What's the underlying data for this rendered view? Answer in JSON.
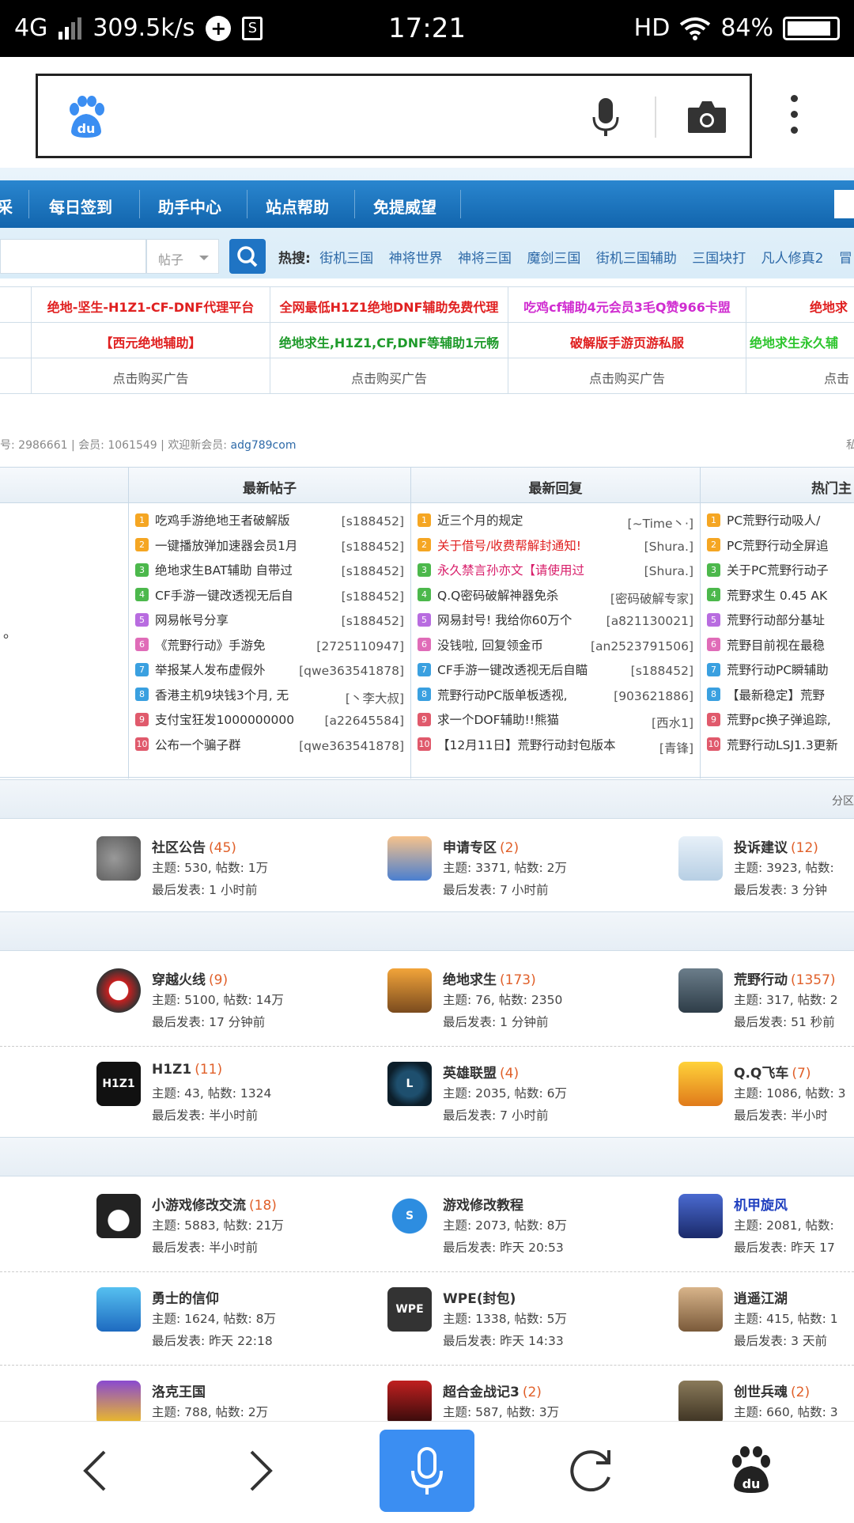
{
  "status_bar": {
    "network": "4G",
    "speed": "309.5k/s",
    "time": "17:21",
    "hd": "HD",
    "battery": "84%"
  },
  "browser": {
    "search_placeholder": "",
    "icons": [
      "baidu-paw-icon",
      "microphone-icon",
      "camera-icon",
      "more-vertical-icon"
    ]
  },
  "nav": {
    "partial_left": "采",
    "items": [
      "每日签到",
      "助手中心",
      "站点帮助",
      "免提威望"
    ]
  },
  "search": {
    "select_label": "帖子",
    "hot_label": "热搜:",
    "hot_terms": [
      "街机三国",
      "神将世界",
      "神将三国",
      "魔剑三国",
      "街机三国辅助",
      "三国块打",
      "凡人修真2",
      "冒"
    ]
  },
  "ads": {
    "row1": [
      "绝地-坚生-H1Z1-CF-DNF代理平台",
      "全网最低H1Z1绝地DNF辅助免费代理",
      "吃鸡cf辅助4元会员3毛Q赞966卡盟",
      "绝地求"
    ],
    "row2": [
      "【西元绝地辅助】",
      "绝地求生,H1Z1,CF,DNF等辅助1元畅",
      "破解版手游页游私服",
      "绝地求生永久辅"
    ],
    "row3": [
      "点击购买广告",
      "点击购买广告",
      "点击购买广告",
      "点击"
    ]
  },
  "stats": {
    "posts": "号: 2986661",
    "members": "会员: 1061549",
    "welcome": "欢迎新会员: ",
    "new_member": "adg789com",
    "right_partial": "私"
  },
  "lists": {
    "headers": [
      "最新帖子",
      "最新回复",
      "热门主"
    ],
    "left_partial": "。",
    "latest_posts": [
      {
        "title": "吃鸡手游绝地王者破解版",
        "author": "[s188452]"
      },
      {
        "title": "一键播放弹加速器会员1月",
        "author": "[s188452]"
      },
      {
        "title": "绝地求生BAT辅助 自带过",
        "author": "[s188452]"
      },
      {
        "title": "CF手游一键改透视无后自",
        "author": "[s188452]"
      },
      {
        "title": "网易帐号分享",
        "author": "[s188452]"
      },
      {
        "title": "《荒野行动》手游免",
        "author": "[2725110947]"
      },
      {
        "title": "举报某人发布虚假外",
        "author": "[qwe363541878]"
      },
      {
        "title": "香港主机9块钱3个月, 无",
        "author": "[丶李大叔]"
      },
      {
        "title": "支付宝狂发1000000000",
        "author": "[a22645584]"
      },
      {
        "title": "公布一个骗子群",
        "author": "[qwe363541878]"
      }
    ],
    "latest_replies": [
      {
        "title": "近三个月的规定",
        "author": "[~Time丶·]",
        "color": "#333"
      },
      {
        "title": "关于借号/收费帮解封通知!",
        "author": "[Shura.]",
        "color": "#e02020"
      },
      {
        "title": "永久禁言孙亦文【请使用过",
        "author": "[Shura.]",
        "color": "#d81e6a"
      },
      {
        "title": "Q.Q密码破解神器免杀",
        "author": "[密码破解专家]",
        "color": "#333"
      },
      {
        "title": "网易封号! 我给你60万个",
        "author": "[a821130021]",
        "color": "#333"
      },
      {
        "title": "没钱啦, 回复领金币",
        "author": "[an2523791506]",
        "color": "#333"
      },
      {
        "title": "CF手游一键改透视无后自瞄",
        "author": "[s188452]",
        "color": "#333"
      },
      {
        "title": "荒野行动PC版单板透视,",
        "author": "[903621886]",
        "color": "#333"
      },
      {
        "title": "求一个DOF辅助!!熊猫",
        "author": "[西水1]",
        "color": "#333"
      },
      {
        "title": "【12月11日】荒野行动封包版本",
        "author": "[青锋]",
        "color": "#333"
      }
    ],
    "hot_topics": [
      "PC荒野行动吸人/",
      "PC荒野行动全屏追",
      "关于PC荒野行动子",
      "荒野求生 0.45 AK",
      "荒野行动部分基址",
      "荒野目前视在最稳",
      "荒野行动PC瞬辅助",
      "【最新稳定】荒野",
      "荒野pc换子弹追踪,",
      "荒野行动LSJ1.3更新"
    ]
  },
  "section1": {
    "right_label": "分区"
  },
  "forums": [
    {
      "name": "社区公告",
      "count": "(45)",
      "topics": "主题: 530, 帖数: 1万",
      "last": "最后发表: 1 小时前",
      "icon": "speaker-icon",
      "name_color": "#333"
    },
    {
      "name": "申请专区",
      "count": "(2)",
      "topics": "主题: 3371, 帖数: 2万",
      "last": "最后发表: 7 小时前",
      "icon": "reading-kid-icon",
      "name_color": "#333"
    },
    {
      "name": "投诉建议",
      "count": "(12)",
      "topics": "主题: 3923, 帖数:",
      "last": "最后发表: 3 分钟",
      "icon": "paper-plane-icon",
      "name_color": "#333"
    },
    {
      "name": "穿越火线",
      "count": "(9)",
      "topics": "主题: 5100, 帖数: 14万",
      "last": "最后发表: 17 分钟前",
      "icon": "crossfire-logo-icon",
      "name_color": "#333"
    },
    {
      "name": "绝地求生",
      "count": "(173)",
      "topics": "主题: 76, 帖数: 2350",
      "last": "最后发表: 1 分钟前",
      "icon": "pubg-icon",
      "name_color": "#333"
    },
    {
      "name": "荒野行动",
      "count": "(1357)",
      "topics": "主题: 317, 帖数: 2",
      "last": "最后发表: 51 秒前",
      "icon": "knives-out-icon",
      "name_color": "#333"
    },
    {
      "name": "H1Z1",
      "count": "(11)",
      "topics": "主题: 43, 帖数: 1324",
      "last": "最后发表: 半小时前",
      "icon": "h1z1-logo-icon",
      "name_color": "#333"
    },
    {
      "name": "英雄联盟",
      "count": "(4)",
      "topics": "主题: 2035, 帖数: 6万",
      "last": "最后发表: 7 小时前",
      "icon": "lol-logo-icon",
      "name_color": "#333"
    },
    {
      "name": "Q.Q飞车",
      "count": "(7)",
      "topics": "主题: 1086, 帖数: 3",
      "last": "最后发表: 半小时",
      "icon": "qq-speed-icon",
      "name_color": "#333"
    },
    {
      "name": "小游戏修改交流",
      "count": "(18)",
      "topics": "主题: 5883, 帖数: 21万",
      "last": "最后发表: 半小时前",
      "icon": "penguin-icon",
      "name_color": "#333"
    },
    {
      "name": "游戏修改教程",
      "count": "",
      "topics": "主题: 2073, 帖数: 8万",
      "last": "最后发表: 昨天 20:53",
      "icon": "skype-s-icon",
      "name_color": "#333"
    },
    {
      "name": "机甲旋风",
      "count": "",
      "topics": "主题: 2081, 帖数:",
      "last": "最后发表: 昨天 17",
      "icon": "mecha-icon",
      "name_color": "#1f3fbf"
    },
    {
      "name": "勇士的信仰",
      "count": "",
      "topics": "主题: 1624, 帖数: 8万",
      "last": "最后发表: 昨天 22:18",
      "icon": "warrior-icon",
      "name_color": "#333"
    },
    {
      "name": "WPE(封包)",
      "count": "",
      "topics": "主题: 1338, 帖数: 5万",
      "last": "最后发表: 昨天 14:33",
      "icon": "wpe-logo-icon",
      "name_color": "#333"
    },
    {
      "name": "逍遥江湖",
      "count": "",
      "topics": "主题: 415, 帖数: 1",
      "last": "最后发表: 3 天前",
      "icon": "jianghu-icon",
      "name_color": "#333"
    },
    {
      "name": "洛克王国",
      "count": "",
      "topics": "主题: 788, 帖数: 2万",
      "last": "",
      "icon": "roco-icon",
      "name_color": "#333"
    },
    {
      "name": "超合金战记3",
      "count": "(2)",
      "topics": "主题: 587, 帖数: 3万",
      "last": "",
      "icon": "alloy-warrior-icon",
      "name_color": "#333"
    },
    {
      "name": "创世兵魂",
      "count": "(2)",
      "topics": "主题: 660, 帖数: 3",
      "last": "",
      "icon": "soldier-icon",
      "name_color": "#333"
    }
  ],
  "bottom_nav": [
    "back-icon",
    "forward-icon",
    "voice-search-icon",
    "refresh-icon",
    "baidu-home-icon"
  ]
}
